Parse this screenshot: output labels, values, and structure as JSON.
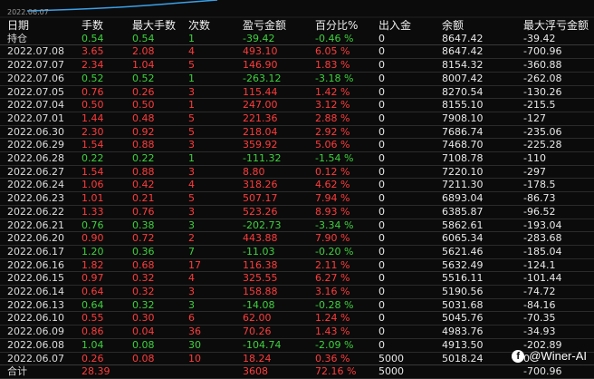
{
  "header_date": "2022.06.07",
  "columns": [
    "日期",
    "手数",
    "最大手数",
    "次数",
    "盈亏金额",
    "百分比%",
    "出入金",
    "余额",
    "最大浮亏金额"
  ],
  "hold_row": {
    "date": "持仓",
    "lots": "0.54",
    "max_lots": "0.54",
    "count": "1",
    "pnl": "-39.42",
    "pct": "-0.46 %",
    "flow": "0",
    "balance": "8647.42",
    "max_float_loss": "-39.42",
    "color": "green"
  },
  "rows": [
    {
      "date": "2022.07.08",
      "lots": "3.65",
      "max_lots": "2.08",
      "count": "4",
      "pnl": "493.10",
      "pct": "6.05 %",
      "flow": "0",
      "balance": "8647.42",
      "max_float_loss": "-700.96",
      "color": "red"
    },
    {
      "date": "2022.07.07",
      "lots": "2.34",
      "max_lots": "1.04",
      "count": "5",
      "pnl": "146.90",
      "pct": "1.83 %",
      "flow": "0",
      "balance": "8154.32",
      "max_float_loss": "-360.88",
      "color": "red"
    },
    {
      "date": "2022.07.06",
      "lots": "0.52",
      "max_lots": "0.52",
      "count": "1",
      "pnl": "-263.12",
      "pct": "-3.18 %",
      "flow": "0",
      "balance": "8007.42",
      "max_float_loss": "-262.08",
      "color": "green"
    },
    {
      "date": "2022.07.05",
      "lots": "0.76",
      "max_lots": "0.26",
      "count": "3",
      "pnl": "115.44",
      "pct": "1.42 %",
      "flow": "0",
      "balance": "8270.54",
      "max_float_loss": "-130.26",
      "color": "red"
    },
    {
      "date": "2022.07.04",
      "lots": "0.50",
      "max_lots": "0.50",
      "count": "1",
      "pnl": "247.00",
      "pct": "3.12 %",
      "flow": "0",
      "balance": "8155.10",
      "max_float_loss": "-215.5",
      "color": "red"
    },
    {
      "date": "2022.07.01",
      "lots": "1.44",
      "max_lots": "0.48",
      "count": "5",
      "pnl": "221.36",
      "pct": "2.88 %",
      "flow": "0",
      "balance": "7908.10",
      "max_float_loss": "-127",
      "color": "red"
    },
    {
      "date": "2022.06.30",
      "lots": "2.30",
      "max_lots": "0.92",
      "count": "5",
      "pnl": "218.04",
      "pct": "2.92 %",
      "flow": "0",
      "balance": "7686.74",
      "max_float_loss": "-235.06",
      "color": "red"
    },
    {
      "date": "2022.06.29",
      "lots": "1.54",
      "max_lots": "0.88",
      "count": "3",
      "pnl": "359.92",
      "pct": "5.06 %",
      "flow": "0",
      "balance": "7468.70",
      "max_float_loss": "-225.28",
      "color": "red"
    },
    {
      "date": "2022.06.28",
      "lots": "0.22",
      "max_lots": "0.22",
      "count": "1",
      "pnl": "-111.32",
      "pct": "-1.54 %",
      "flow": "0",
      "balance": "7108.78",
      "max_float_loss": "-110",
      "color": "green"
    },
    {
      "date": "2022.06.27",
      "lots": "1.54",
      "max_lots": "0.88",
      "count": "3",
      "pnl": "8.80",
      "pct": "0.12 %",
      "flow": "0",
      "balance": "7220.10",
      "max_float_loss": "-297",
      "color": "red"
    },
    {
      "date": "2022.06.24",
      "lots": "1.06",
      "max_lots": "0.42",
      "count": "4",
      "pnl": "318.26",
      "pct": "4.62 %",
      "flow": "0",
      "balance": "7211.30",
      "max_float_loss": "-178.5",
      "color": "red"
    },
    {
      "date": "2022.06.23",
      "lots": "1.01",
      "max_lots": "0.21",
      "count": "5",
      "pnl": "507.17",
      "pct": "7.94 %",
      "flow": "0",
      "balance": "6893.04",
      "max_float_loss": "-86.73",
      "color": "red"
    },
    {
      "date": "2022.06.22",
      "lots": "1.33",
      "max_lots": "0.76",
      "count": "3",
      "pnl": "523.26",
      "pct": "8.93 %",
      "flow": "0",
      "balance": "6385.87",
      "max_float_loss": "-96.52",
      "color": "red"
    },
    {
      "date": "2022.06.21",
      "lots": "0.76",
      "max_lots": "0.38",
      "count": "3",
      "pnl": "-202.73",
      "pct": "-3.34 %",
      "flow": "0",
      "balance": "5862.61",
      "max_float_loss": "-193.04",
      "color": "green"
    },
    {
      "date": "2022.06.20",
      "lots": "0.90",
      "max_lots": "0.72",
      "count": "2",
      "pnl": "443.88",
      "pct": "7.90 %",
      "flow": "0",
      "balance": "6065.34",
      "max_float_loss": "-283.68",
      "color": "red"
    },
    {
      "date": "2022.06.17",
      "lots": "1.20",
      "max_lots": "0.36",
      "count": "7",
      "pnl": "-11.03",
      "pct": "-0.20 %",
      "flow": "0",
      "balance": "5621.46",
      "max_float_loss": "-185.04",
      "color": "green"
    },
    {
      "date": "2022.06.16",
      "lots": "1.82",
      "max_lots": "0.68",
      "count": "17",
      "pnl": "116.38",
      "pct": "2.11 %",
      "flow": "0",
      "balance": "5632.49",
      "max_float_loss": "-124.1",
      "color": "red"
    },
    {
      "date": "2022.06.15",
      "lots": "0.97",
      "max_lots": "0.32",
      "count": "4",
      "pnl": "325.55",
      "pct": "6.27 %",
      "flow": "0",
      "balance": "5516.11",
      "max_float_loss": "-101.44",
      "color": "red"
    },
    {
      "date": "2022.06.14",
      "lots": "0.64",
      "max_lots": "0.32",
      "count": "3",
      "pnl": "158.88",
      "pct": "3.16 %",
      "flow": "0",
      "balance": "5190.56",
      "max_float_loss": "-74.72",
      "color": "red"
    },
    {
      "date": "2022.06.13",
      "lots": "0.64",
      "max_lots": "0.32",
      "count": "3",
      "pnl": "-14.08",
      "pct": "-0.28 %",
      "flow": "0",
      "balance": "5031.68",
      "max_float_loss": "-84.16",
      "color": "green"
    },
    {
      "date": "2022.06.10",
      "lots": "0.55",
      "max_lots": "0.30",
      "count": "6",
      "pnl": "62.00",
      "pct": "1.24 %",
      "flow": "0",
      "balance": "5045.76",
      "max_float_loss": "-70.35",
      "color": "red"
    },
    {
      "date": "2022.06.09",
      "lots": "0.86",
      "max_lots": "0.04",
      "count": "36",
      "pnl": "70.26",
      "pct": "1.43 %",
      "flow": "0",
      "balance": "4983.76",
      "max_float_loss": "-34.93",
      "color": "red"
    },
    {
      "date": "2022.06.08",
      "lots": "1.04",
      "max_lots": "0.08",
      "count": "30",
      "pnl": "-104.74",
      "pct": "-2.09 %",
      "flow": "0",
      "balance": "4913.50",
      "max_float_loss": "-202.89",
      "color": "green"
    },
    {
      "date": "2022.06.07",
      "lots": "0.26",
      "max_lots": "0.08",
      "count": "10",
      "pnl": "18.24",
      "pct": "0.36 %",
      "flow": "5000",
      "balance": "5018.24",
      "max_float_loss": "0",
      "color": "red"
    }
  ],
  "total_row": {
    "date": "合计",
    "lots": "28.39",
    "max_lots": "",
    "count": "",
    "pnl": "3608",
    "pct": "72.16 %",
    "flow": "5000",
    "balance": "",
    "max_float_loss": "-700.96",
    "color": "red"
  },
  "watermark": {
    "icon": "facebook-icon",
    "text": "@Winer-AI"
  },
  "colors": {
    "red": "#ff3b3b",
    "green": "#3cd23c",
    "background": "#0b0b0b",
    "equity_line": "#3aa0e8"
  }
}
